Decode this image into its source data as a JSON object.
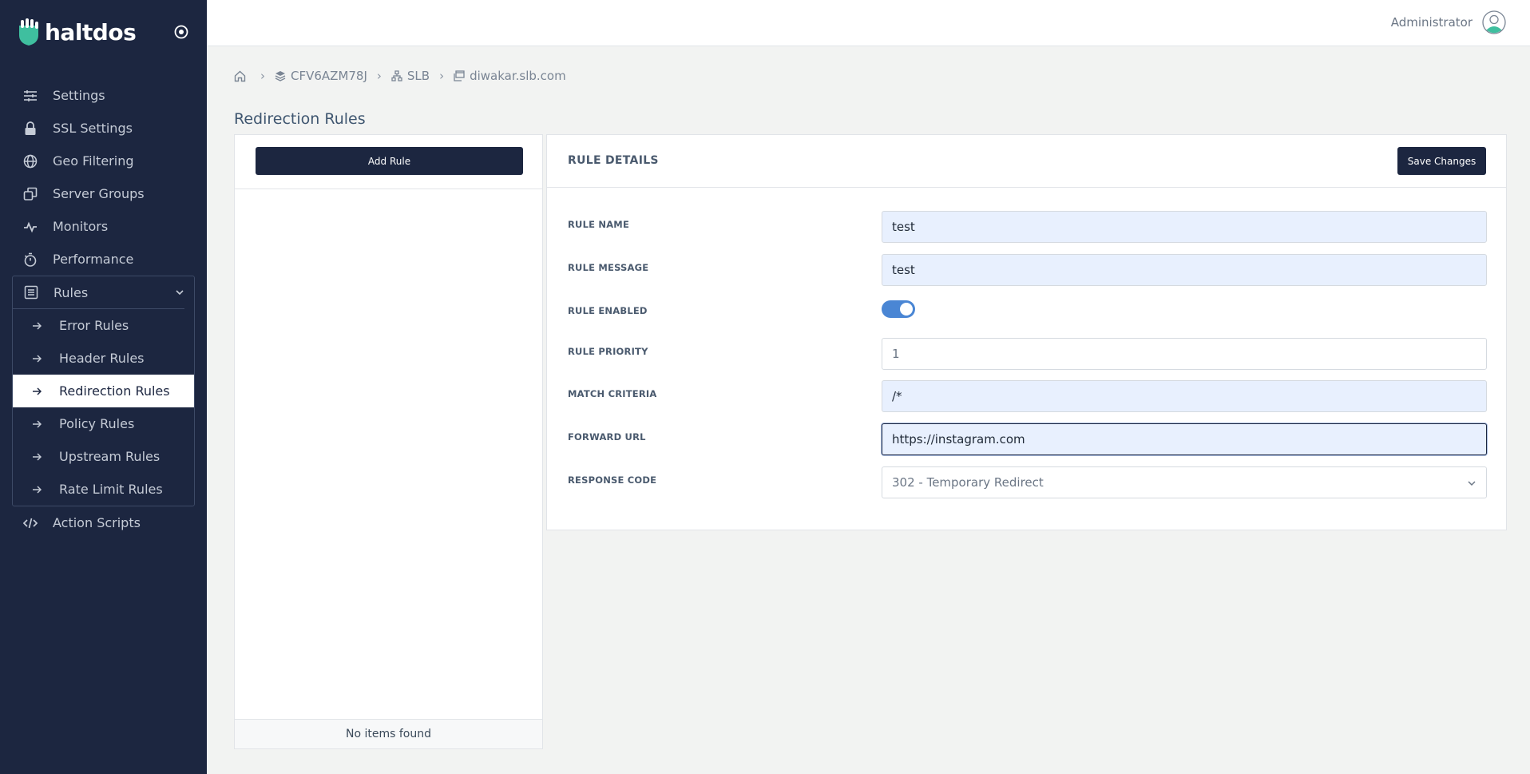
{
  "brand": {
    "name": "haltdos"
  },
  "colors": {
    "sidebar_bg": "#1c2640",
    "accent": "#4a86d4",
    "teal": "#3fbf9f"
  },
  "sidebar": {
    "items": [
      {
        "label": "Settings",
        "icon": "sliders-icon"
      },
      {
        "label": "SSL Settings",
        "icon": "lock-icon"
      },
      {
        "label": "Geo Filtering",
        "icon": "globe-icon"
      },
      {
        "label": "Server Groups",
        "icon": "copy-icon"
      },
      {
        "label": "Monitors",
        "icon": "activity-icon"
      },
      {
        "label": "Performance",
        "icon": "stopwatch-icon"
      }
    ],
    "rules_group": {
      "label": "Rules",
      "icon": "list-icon",
      "children": [
        {
          "label": "Error Rules"
        },
        {
          "label": "Header Rules"
        },
        {
          "label": "Redirection Rules",
          "active": true
        },
        {
          "label": "Policy Rules"
        },
        {
          "label": "Upstream Rules"
        },
        {
          "label": "Rate Limit Rules"
        }
      ]
    },
    "after": [
      {
        "label": "Action Scripts",
        "icon": "code-icon"
      }
    ]
  },
  "header": {
    "user_name": "Administrator"
  },
  "breadcrumb": {
    "node": "CFV6AZM78J",
    "group": "SLB",
    "site": "diwakar.slb.com"
  },
  "page": {
    "title": "Redirection Rules"
  },
  "left_panel": {
    "add_label": "Add Rule",
    "empty_text": "No items found"
  },
  "rule_details": {
    "title": "RULE DETAILS",
    "save_label": "Save Changes",
    "fields": {
      "name_label": "RULE NAME",
      "name_value": "test",
      "message_label": "RULE MESSAGE",
      "message_value": "test",
      "enabled_label": "RULE ENABLED",
      "enabled": true,
      "priority_label": "RULE PRIORITY",
      "priority_value": "1",
      "match_label": "MATCH CRITERIA",
      "match_value": "/*",
      "forward_label": "FORWARD URL",
      "forward_value": "https://instagram.com",
      "response_label": "RESPONSE CODE",
      "response_value": "302 - Temporary Redirect"
    }
  }
}
